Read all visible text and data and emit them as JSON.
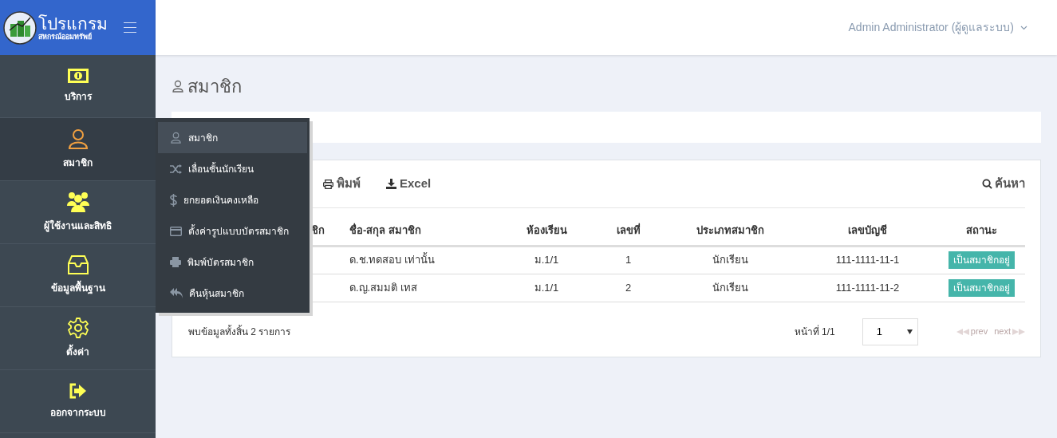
{
  "brand": {
    "title": "โปรแกรม",
    "subtitle": "สหกรณ์ออมทรัพย์"
  },
  "user_menu": {
    "label": "Admin Administrator (ผู้ดูแลระบบ)"
  },
  "sidebar": {
    "items": [
      {
        "kind": "money",
        "label": "บริการ",
        "selected": false
      },
      {
        "kind": "user",
        "label": "สมาชิก",
        "selected": true
      },
      {
        "kind": "users",
        "label": "ผู้ใช้งานและสิทธิ",
        "selected": false
      },
      {
        "kind": "inbox",
        "label": "ข้อมูลพื้นฐาน",
        "selected": false
      },
      {
        "kind": "gear",
        "label": "ตั้งค่า",
        "selected": false
      },
      {
        "kind": "logout",
        "label": "ออกจากระบบ",
        "selected": false
      }
    ]
  },
  "submenu": {
    "items": [
      {
        "kind": "user",
        "label": "สมาชิก",
        "selected": true
      },
      {
        "kind": "shuffle",
        "label": "เลื่อนชั้นนักเรียน",
        "selected": false
      },
      {
        "kind": "dollar",
        "label": "ยกยอดเงินคงเหลือ",
        "selected": false
      },
      {
        "kind": "card",
        "label": "ตั้งค่ารูปแบบบัตรสมาชิก",
        "selected": false
      },
      {
        "kind": "print",
        "label": "พิมพ์บัตรสมาชิก",
        "selected": false
      },
      {
        "kind": "reply",
        "label": "คืนหุ้นสมาชิก",
        "selected": false
      }
    ]
  },
  "page_title": "สมาชิก",
  "toolbar": {
    "buttons": [
      {
        "kind": "print",
        "label": "พิมพ์"
      },
      {
        "kind": "download",
        "label": "Excel"
      }
    ],
    "search": "ค้นหา"
  },
  "table": {
    "columns": [
      "ชิก",
      "ชื่อ-สกุล สมาชิก",
      "ห้องเรียน",
      "เลขที่",
      "ประเภทสมาชิก",
      "เลขบัญชี",
      "สถานะ"
    ],
    "rows": [
      {
        "name": "ด.ช.ทดสอบ เท่านั้น",
        "room": "ม.1/1",
        "number": "1",
        "type": "นักเรียน",
        "account": "111-1111-11-1",
        "status": "เป็นสมาชิกอยู่"
      },
      {
        "name": "ด.ญ.สมมติ เทส",
        "room": "ม.1/1",
        "number": "2",
        "type": "นักเรียน",
        "account": "111-1111-11-2",
        "status": "เป็นสมาชิกอยู่"
      }
    ]
  },
  "footer": {
    "total": "พบข้อมูลทั้งสิ้น 2 รายการ",
    "page_label": "หน้าที่ 1/1",
    "page_select": "1",
    "prev": "prev",
    "next": "next"
  }
}
